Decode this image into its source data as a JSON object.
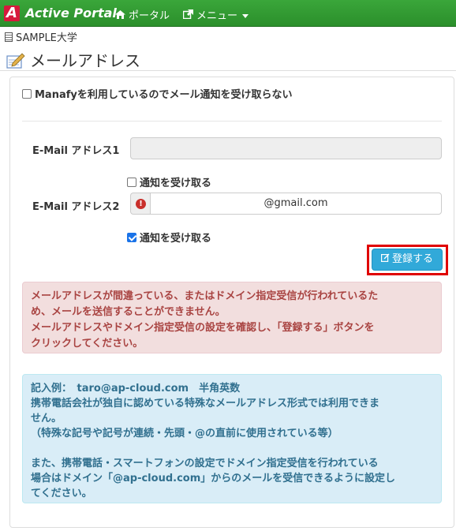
{
  "navbar": {
    "logo_letter": "A",
    "brand": "Active Portal",
    "portal_label": "ポータル",
    "menu_label": "メニュー"
  },
  "school": "SAMPLE大学",
  "page_title": "メールアドレス",
  "form": {
    "manafy_label": "Manafyを利用しているのでメール通知を受け取らない",
    "manafy_checked": false,
    "email1_label": "E-Mail アドレス1",
    "email1_value": "",
    "notify1_label": "通知を受け取る",
    "notify1_checked": false,
    "email2_label": "E-Mail アドレス2",
    "email2_value": "@gmail.com",
    "notify2_label": "通知を受け取る",
    "notify2_checked": true,
    "submit_label": "登録する"
  },
  "alert_danger": {
    "line1": "メールアドレスが間違っている、またはドメイン指定受信が行われているた",
    "line2": "め、メールを送信することができません。",
    "line3": "メールアドレスやドメイン指定受信の設定を確認し、「登録する」ボタンを",
    "line4": "クリックしてください。"
  },
  "alert_info": {
    "line1": "記入例：　taro@ap-cloud.com　半角英数",
    "line2": "携帯電話会社が独自に認めている特殊なメールアドレス形式では利用できま",
    "line3": "せん。",
    "line4": "（特殊な記号や記号が連続・先頭・@の直前に使用されている等）",
    "line5": "また、携帯電話・スマートフォンの設定でドメイン指定受信を行われている",
    "line6": "場合はドメイン「@ap-cloud.com」からのメールを受信できるように設定し",
    "line7": "てください。"
  },
  "colors": {
    "navbar": "#2b8f2b",
    "logo": "#d61a3c",
    "button": "#31a9d9",
    "highlight": "#e00000",
    "danger_bg": "#f2dede",
    "info_bg": "#d9edf7"
  }
}
